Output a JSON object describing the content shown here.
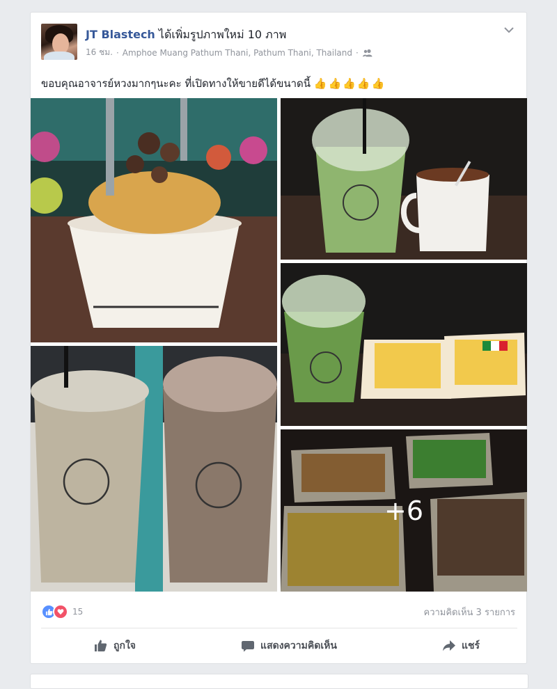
{
  "post": {
    "author": "JT Blastech",
    "action_text": "ได้เพิ่มรูปภาพใหม่ 10 ภาพ",
    "time": "16 ชม.",
    "location": "Amphoe Muang Pathum Thani, Pathum Thani, Thailand",
    "separator": "·",
    "audience_icon": "friends-icon",
    "message": "ขอบคุณอาจารย์หวงมากๆนะคะ ที่เปิดทางให้ขายดีได้ขนาดนี้",
    "message_emoji": "👍👍👍👍👍"
  },
  "photos": {
    "more_count": "+6"
  },
  "footer": {
    "reaction_count": "15",
    "comment_summary": "ความคิดเห็น 3 รายการ",
    "like_label": "ถูกใจ",
    "comment_label": "แสดงความคิดเห็น",
    "share_label": "แชร์"
  },
  "colors": {
    "background": "#e9ebee",
    "author_link": "#365899",
    "like_blue": "#5890ff",
    "love_red": "#f25268",
    "muted": "#90949c"
  }
}
